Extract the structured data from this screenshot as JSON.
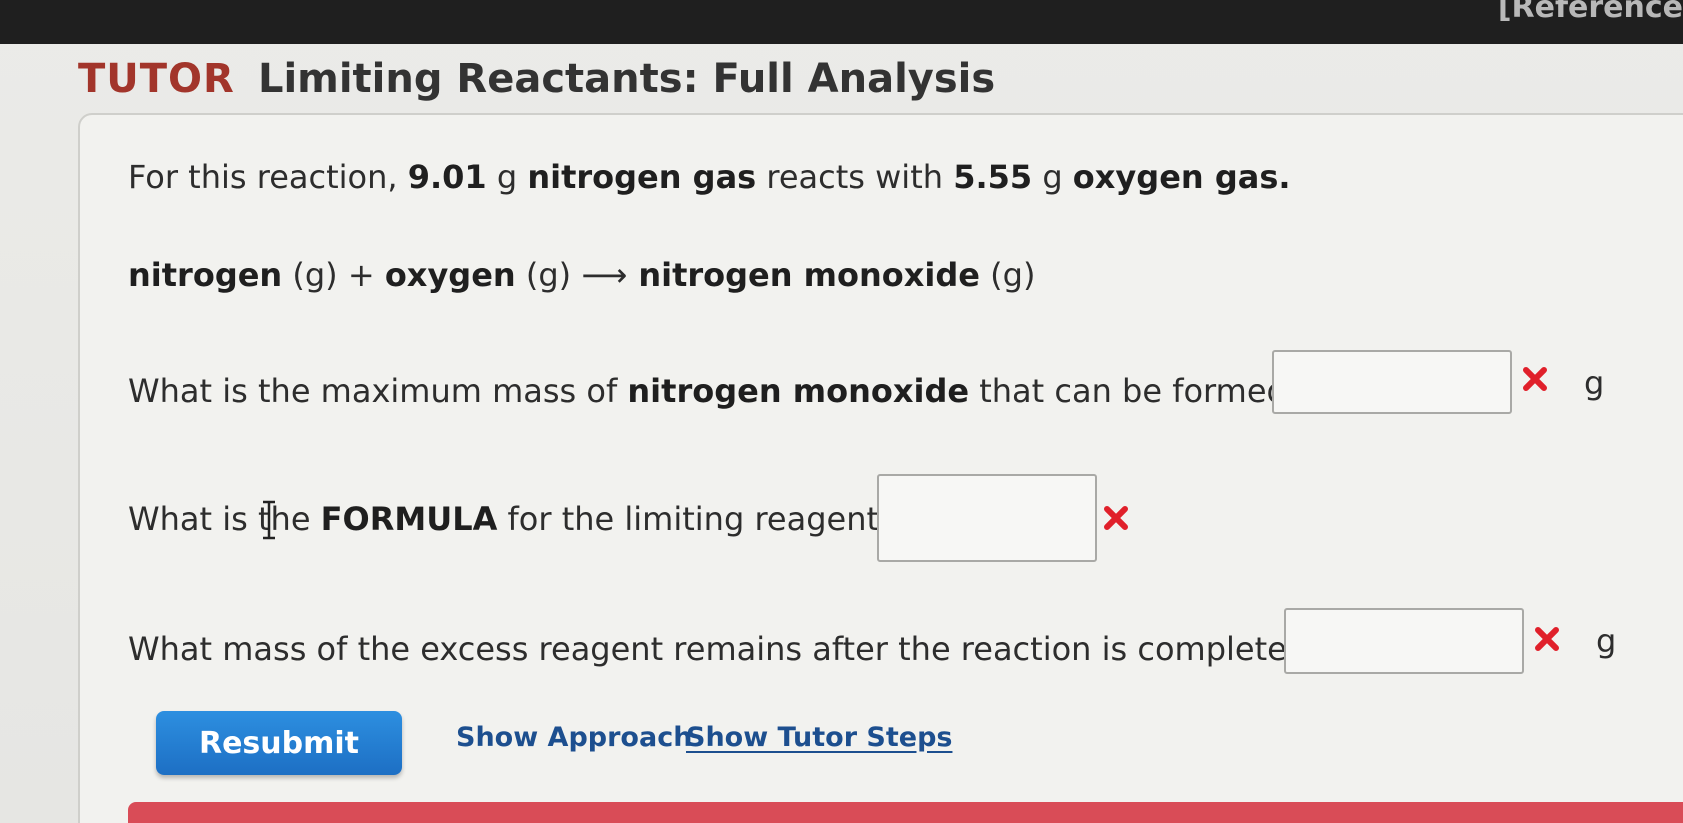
{
  "header": {
    "ref_label": "[Reference",
    "tutor_label": "TUTOR",
    "title": "Limiting Reactants: Full Analysis"
  },
  "problem": {
    "intro": {
      "p1": "For this reaction, ",
      "mass1": "9.01",
      "p2": " g ",
      "substance1": "nitrogen gas",
      "p3": " reacts with ",
      "mass2": "5.55",
      "p4": " g ",
      "substance2": "oxygen gas."
    },
    "equation": {
      "reactant1": "nitrogen",
      "state1": " (g) + ",
      "reactant2": "oxygen",
      "state2": " (g) ",
      "arrow": "⟶",
      "product": " nitrogen monoxide",
      "state3": " (g)"
    }
  },
  "questions": {
    "q1": {
      "p1": "What is the maximum mass of ",
      "bold": "nitrogen monoxide",
      "p2": " that can be formed?",
      "answer": "",
      "unit": "g",
      "status": "incorrect"
    },
    "q2": {
      "p1": "What is the ",
      "bold": "FORMULA",
      "p2": " for the limiting reagent?",
      "answer": "",
      "status": "incorrect"
    },
    "q3": {
      "text": "What mass of the excess reagent remains after the reaction is complete?",
      "answer": "",
      "unit": "g",
      "status": "incorrect"
    }
  },
  "actions": {
    "resubmit_label": "Resubmit",
    "show_approach_label": "Show Approach",
    "show_tutor_steps_label": "Show Tutor Steps"
  },
  "colors": {
    "tutor_red": "#a2352b",
    "incorrect_red": "#e0202a",
    "button_blue": "#1d6fc4",
    "link_blue": "#1d4f8f",
    "strip_red": "#d94c57"
  }
}
